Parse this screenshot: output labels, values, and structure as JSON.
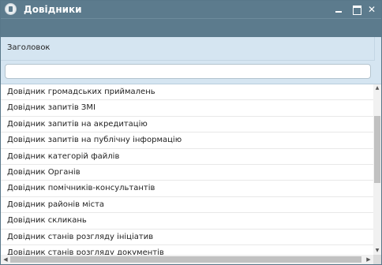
{
  "window": {
    "title": "Довідники"
  },
  "grid": {
    "column_header": "Заголовок",
    "filter_value": "",
    "rows": [
      "Довідник громадських приймалень",
      "Довідник запитів ЗМІ",
      "Довідник запитів на акредитацію",
      "Довідник запитів на публічну інформацію",
      "Довідник категорій файлів",
      "Довідник Органів",
      "Довідник помічників-консультантів",
      "Довідник районів міста",
      "Довідник скликань",
      "Довідник станів розгляду ініціатив",
      "Довідник станів розгляду документів"
    ]
  },
  "icons": {
    "app": "app-icon",
    "minimize": "minimize-icon",
    "maximize": "maximize-icon",
    "close": "close-icon"
  },
  "colors": {
    "titlebar": "#5c7b8d",
    "header": "#d5e5f1"
  }
}
